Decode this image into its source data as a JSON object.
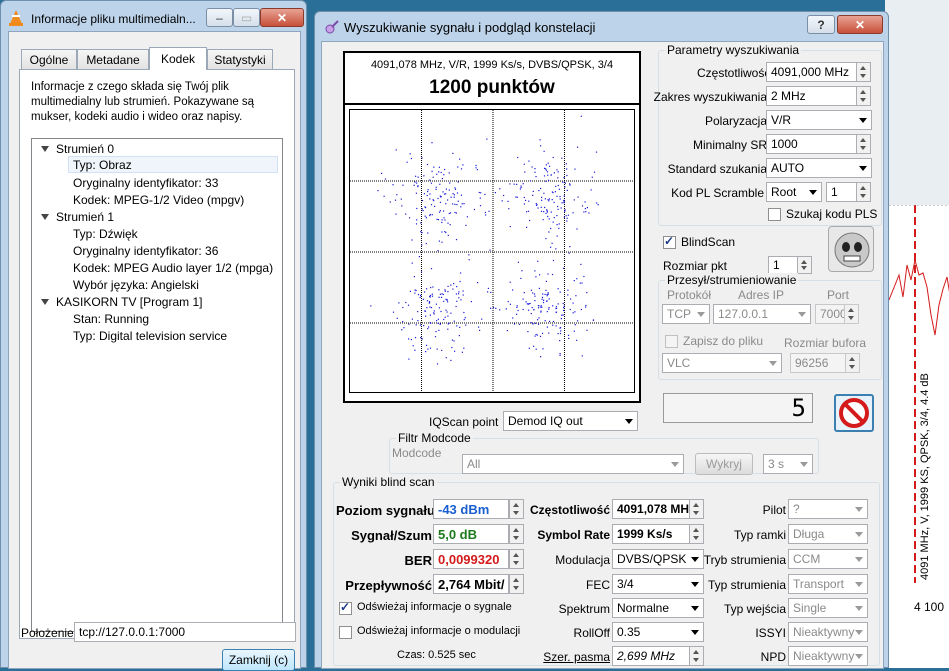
{
  "media_info": {
    "title": "Informacje pliku multimedialn...",
    "tabs": [
      "Ogólne",
      "Metadane",
      "Kodek",
      "Statystyki"
    ],
    "description": "Informacje z czego składa się Twój plik multimedialny lub strumień. Pokazywane są mukser, kodeki audio i wideo oraz napisy.",
    "tree": [
      {
        "label": "Strumień 0",
        "children": [
          "Typ: Obraz",
          "Oryginalny identyfikator: 33",
          "Kodek: MPEG-1/2 Video (mpgv)"
        ]
      },
      {
        "label": "Strumień 1",
        "children": [
          "Typ: Dźwięk",
          "Oryginalny identyfikator: 36",
          "Kodek: MPEG Audio layer 1/2 (mpga)",
          "Wybór języka: Angielski"
        ]
      },
      {
        "label": "KASIKORN TV  [Program 1]",
        "children": [
          "Stan: Running",
          "Typ: Digital television service"
        ]
      }
    ],
    "location_label": "Położenie:",
    "location_value": "tcp://127.0.0.1:7000",
    "close_button": "Zamknij (c)"
  },
  "scan": {
    "title": "Wyszukiwanie sygnału i podgląd konstelacji",
    "help_button": "?",
    "plot_info": "4091,078 MHz, V/R, 1999 Ks/s, DVBS/QPSK, 3/4",
    "plot_points": "1200 punktów",
    "iqscan_label": "IQScan point",
    "iqscan_value": "Demod IQ out",
    "params": {
      "legend": "Parametry wyszukiwania",
      "freq_label": "Częstotliwość",
      "freq_value": "4091,000 MHz",
      "range_label": "Zakres wyszukiwania",
      "range_value": "2 MHz",
      "pol_label": "Polaryzacja",
      "pol_value": "V/R",
      "minsr_label": "Minimalny SR",
      "minsr_value": "1000",
      "std_label": "Standard szukania",
      "std_value": "AUTO",
      "pl_label": "Kod PL Scramble",
      "pl_mode": "Root",
      "pl_value": "1",
      "pls_label": "Szukaj kodu PLS"
    },
    "blindscan_label": "BlindScan",
    "rozmiar_label": "Rozmiar pkt",
    "rozmiar_value": "1",
    "stream": {
      "legend": "Przesył/strumieniowanie",
      "protokol_label": "Protokół",
      "protokol_value": "TCP",
      "adres_label": "Adres IP",
      "adres_value": "127.0.0.1",
      "port_label": "Port",
      "port_value": "7000",
      "zapisz_label": "Zapisz do pliku",
      "bufor_label": "Rozmiar bufora",
      "player_value": "VLC",
      "bufor_value": "96256"
    },
    "counter": "5",
    "modcode": {
      "legend": "Filtr Modcode",
      "label": "Modcode",
      "value": "All",
      "detect_button": "Wykryj",
      "time_value": "3 s"
    },
    "results": {
      "legend": "Wyniki blind scan",
      "level_label": "Poziom sygnału",
      "level_value": "-43 dBm",
      "snr_label": "Sygnał/Szum",
      "snr_value": "5,0 dB",
      "ber_label": "BER",
      "ber_value": "0,0099320",
      "rate_label": "Przepływność",
      "rate_value": "2,764 Mbit/",
      "refresh_signal": "Odświeżaj informacje o sygnale",
      "refresh_mod": "Odświeżaj informacje o modulacji",
      "time_text": "Czas: 0.525 sec",
      "freq_label": "Częstotliwość",
      "freq_value": "4091,078 MH",
      "sr_label": "Symbol Rate",
      "sr_value": "1999 Ks/s",
      "mod_label": "Modulacja",
      "mod_value": "DVBS/QPSK",
      "fec_label": "FEC",
      "fec_value": "3/4",
      "spec_label": "Spektrum",
      "spec_value": "Normalne",
      "roll_label": "RollOff",
      "roll_value": "0.35",
      "bw_label": "Szer. pasma",
      "bw_value": "2,699 MHz",
      "pilot_label": "Pilot",
      "pilot_value": "?",
      "frame_label": "Typ ramki",
      "frame_value": "Długa",
      "tryb_label": "Tryb strumienia",
      "tryb_value": "CCM",
      "typs_label": "Typ strumienia",
      "typs_value": "Transport",
      "input_label": "Typ wejścia",
      "input_value": "Single",
      "issyi_label": "ISSYI",
      "issyi_value": "Nieaktywny",
      "npd_label": "NPD",
      "npd_value": "Nieaktywny"
    }
  },
  "spectrum_bg": {
    "rotated_label": "4091 MHz, V, 1999 KS, QPSK, 3/4, 4.4 dB",
    "axis_tick": "4 100"
  },
  "colors": {
    "level": "#1a5fd0",
    "snr": "#1c7a1c",
    "ber": "#d41a1a",
    "constellation": "#1a1ad8"
  }
}
